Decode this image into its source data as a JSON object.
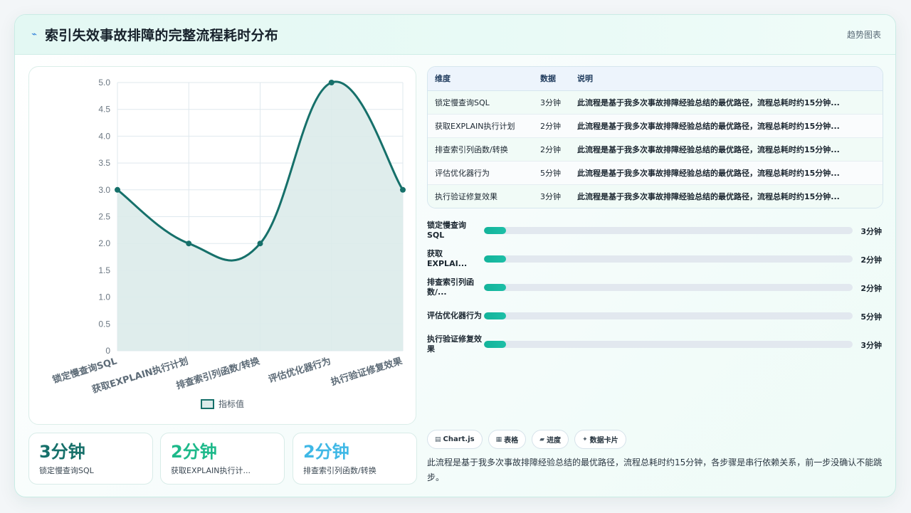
{
  "header": {
    "icon": "sparkline-icon",
    "title": "索引失效事故排障的完整流程耗时分布",
    "tag": "趋势图表"
  },
  "chart_data": {
    "type": "line",
    "fill": true,
    "smooth": true,
    "categories": [
      "锁定慢查询SQL",
      "获取EXPLAIN执行计划",
      "排查索引列函数/转换",
      "评估优化器行为",
      "执行验证修复效果"
    ],
    "series": [
      {
        "name": "指标值",
        "values": [
          3,
          2,
          2,
          5,
          3
        ]
      }
    ],
    "ylim": [
      0,
      5
    ],
    "yticks": [
      "0",
      "0.5",
      "1.0",
      "1.5",
      "2.0",
      "2.5",
      "3.0",
      "3.5",
      "4.0",
      "4.5",
      "5.0"
    ],
    "grid": true,
    "legend": "bottom",
    "colors": {
      "line": "#16706a",
      "fill": "#dcebea",
      "grid": "#dfe8ee"
    }
  },
  "stats": [
    {
      "value": "3分钟",
      "label": "锁定慢查询SQL",
      "color": "#16706a"
    },
    {
      "value": "2分钟",
      "label": "获取EXPLAIN执行计...",
      "color": "#1db98a"
    },
    {
      "value": "2分钟",
      "label": "排查索引列函数/转换",
      "color": "#3fb8e6"
    }
  ],
  "table": {
    "headers": [
      "维度",
      "数据",
      "说明"
    ],
    "rows": [
      [
        "锁定慢查询SQL",
        "3分钟",
        "此流程是基于我多次事故排障经验总结的最优路径，流程总耗时约15分钟..."
      ],
      [
        "获取EXPLAIN执行计划",
        "2分钟",
        "此流程是基于我多次事故排障经验总结的最优路径，流程总耗时约15分钟..."
      ],
      [
        "排查索引列函数/转换",
        "2分钟",
        "此流程是基于我多次事故排障经验总结的最优路径，流程总耗时约15分钟..."
      ],
      [
        "评估优化器行为",
        "5分钟",
        "此流程是基于我多次事故排障经验总结的最优路径，流程总耗时约15分钟..."
      ],
      [
        "执行验证修复效果",
        "3分钟",
        "此流程是基于我多次事故排障经验总结的最优路径，流程总耗时约15分钟..."
      ]
    ]
  },
  "bars": [
    {
      "label": "锁定慢查询SQL",
      "value": "3分钟",
      "fill": 0.06
    },
    {
      "label": "获取EXPLAI...",
      "value": "2分钟",
      "fill": 0.06
    },
    {
      "label": "排查索引列函数/...",
      "value": "2分钟",
      "fill": 0.06
    },
    {
      "label": "评估优化器行为",
      "value": "5分钟",
      "fill": 0.06
    },
    {
      "label": "执行验证修复效果",
      "value": "3分钟",
      "fill": 0.06
    }
  ],
  "chips": [
    {
      "icon": "chart-icon",
      "glyph": "▤",
      "label": "Chart.js"
    },
    {
      "icon": "table-icon",
      "glyph": "▦",
      "label": "表格"
    },
    {
      "icon": "progress-icon",
      "glyph": "▰",
      "label": "进度"
    },
    {
      "icon": "sparkle-icon",
      "glyph": "✦",
      "label": "数据卡片"
    }
  ],
  "summary": "此流程是基于我多次事故排障经验总结的最优路径，流程总耗时约15分钟，各步骤是串行依赖关系，前一步没确认不能跳步。"
}
